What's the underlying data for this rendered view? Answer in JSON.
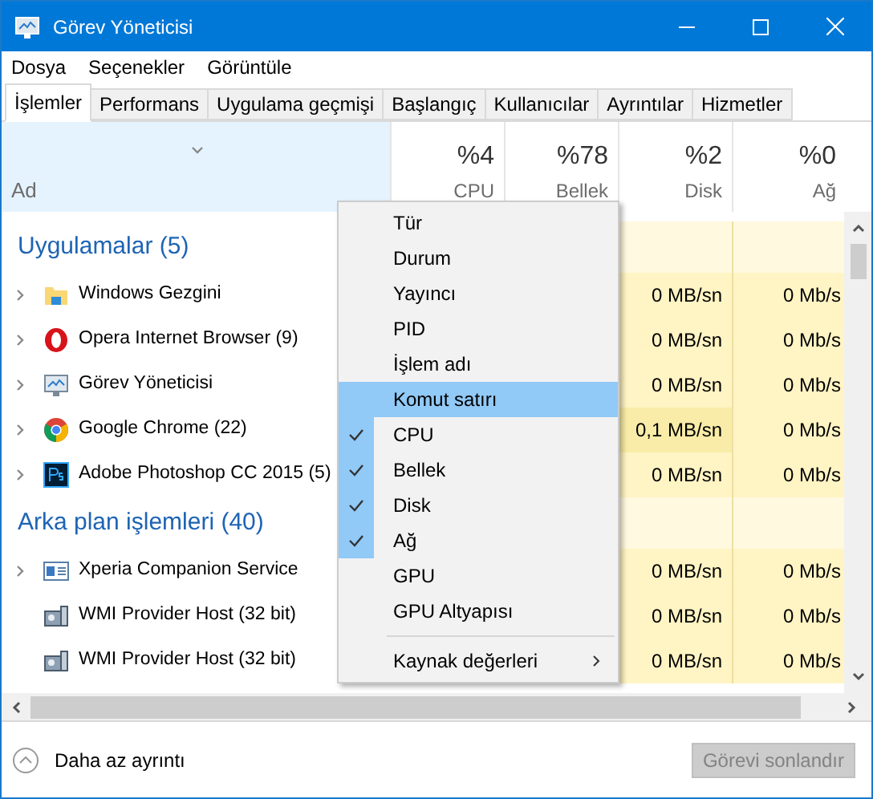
{
  "window": {
    "title": "Görev Yöneticisi"
  },
  "menu_bar": [
    "Dosya",
    "Seçenekler",
    "Görüntüle"
  ],
  "tabs": [
    {
      "label": "İşlemler",
      "selected": true
    },
    {
      "label": "Performans",
      "selected": false
    },
    {
      "label": "Uygulama geçmişi",
      "selected": false
    },
    {
      "label": "Başlangıç",
      "selected": false
    },
    {
      "label": "Kullanıcılar",
      "selected": false
    },
    {
      "label": "Ayrıntılar",
      "selected": false
    },
    {
      "label": "Hizmetler",
      "selected": false
    }
  ],
  "table": {
    "name_column": "Ad",
    "columns": [
      {
        "percent": "%4",
        "label": "CPU"
      },
      {
        "percent": "%78",
        "label": "Bellek"
      },
      {
        "percent": "%2",
        "label": "Disk"
      },
      {
        "percent": "%0",
        "label": "Ağ"
      }
    ],
    "groups": [
      {
        "title": "Uygulamalar (5)",
        "rows": [
          {
            "kind": "folder",
            "name": "Windows Gezgini",
            "expandable": true,
            "disk": "0 MB/sn",
            "network": "0 Mb/s",
            "hot": false
          },
          {
            "kind": "opera",
            "name": "Opera Internet Browser (9)",
            "expandable": true,
            "disk": "0 MB/sn",
            "network": "0 Mb/s",
            "hot": false
          },
          {
            "kind": "monitor",
            "name": "Görev Yöneticisi",
            "expandable": true,
            "disk": "0 MB/sn",
            "network": "0 Mb/s",
            "hot": false
          },
          {
            "kind": "chrome",
            "name": "Google Chrome (22)",
            "expandable": true,
            "disk": "0,1 MB/sn",
            "network": "0 Mb/s",
            "hot": true
          },
          {
            "kind": "ps",
            "name": "Adobe Photoshop CC 2015 (5)",
            "expandable": true,
            "disk": "0 MB/sn",
            "network": "0 Mb/s",
            "hot": false
          }
        ]
      },
      {
        "title": "Arka plan işlemleri (40)",
        "rows": [
          {
            "kind": "service",
            "name": "Xperia Companion Service",
            "expandable": true,
            "disk": "0 MB/sn",
            "network": "0 Mb/s",
            "hot": false
          },
          {
            "kind": "wmi",
            "name": "WMI Provider Host (32 bit)",
            "expandable": false,
            "disk": "0 MB/sn",
            "network": "0 Mb/s",
            "hot": false
          },
          {
            "kind": "wmi",
            "name": "WMI Provider Host (32 bit)",
            "expandable": false,
            "disk": "0 MB/sn",
            "network": "0 Mb/s",
            "hot": false
          }
        ]
      }
    ]
  },
  "context_menu": [
    {
      "label": "Tür",
      "checked": false,
      "selected": false
    },
    {
      "label": "Durum",
      "checked": false,
      "selected": false
    },
    {
      "label": "Yayıncı",
      "checked": false,
      "selected": false
    },
    {
      "label": "PID",
      "checked": false,
      "selected": false
    },
    {
      "label": "İşlem adı",
      "checked": false,
      "selected": false
    },
    {
      "label": "Komut satırı",
      "checked": false,
      "selected": true
    },
    {
      "label": "CPU",
      "checked": true,
      "selected": false
    },
    {
      "label": "Bellek",
      "checked": true,
      "selected": false
    },
    {
      "label": "Disk",
      "checked": true,
      "selected": false
    },
    {
      "label": "Ağ",
      "checked": true,
      "selected": false
    },
    {
      "label": "GPU",
      "checked": false,
      "selected": false
    },
    {
      "label": "GPU Altyapısı",
      "checked": false,
      "selected": false
    },
    {
      "label": "Kaynak değerleri",
      "checked": false,
      "selected": false,
      "submenu": true
    }
  ],
  "footer": {
    "link": "Daha az ayrıntı",
    "button": {
      "label": "Görevi sonlandır",
      "disabled": true
    }
  }
}
